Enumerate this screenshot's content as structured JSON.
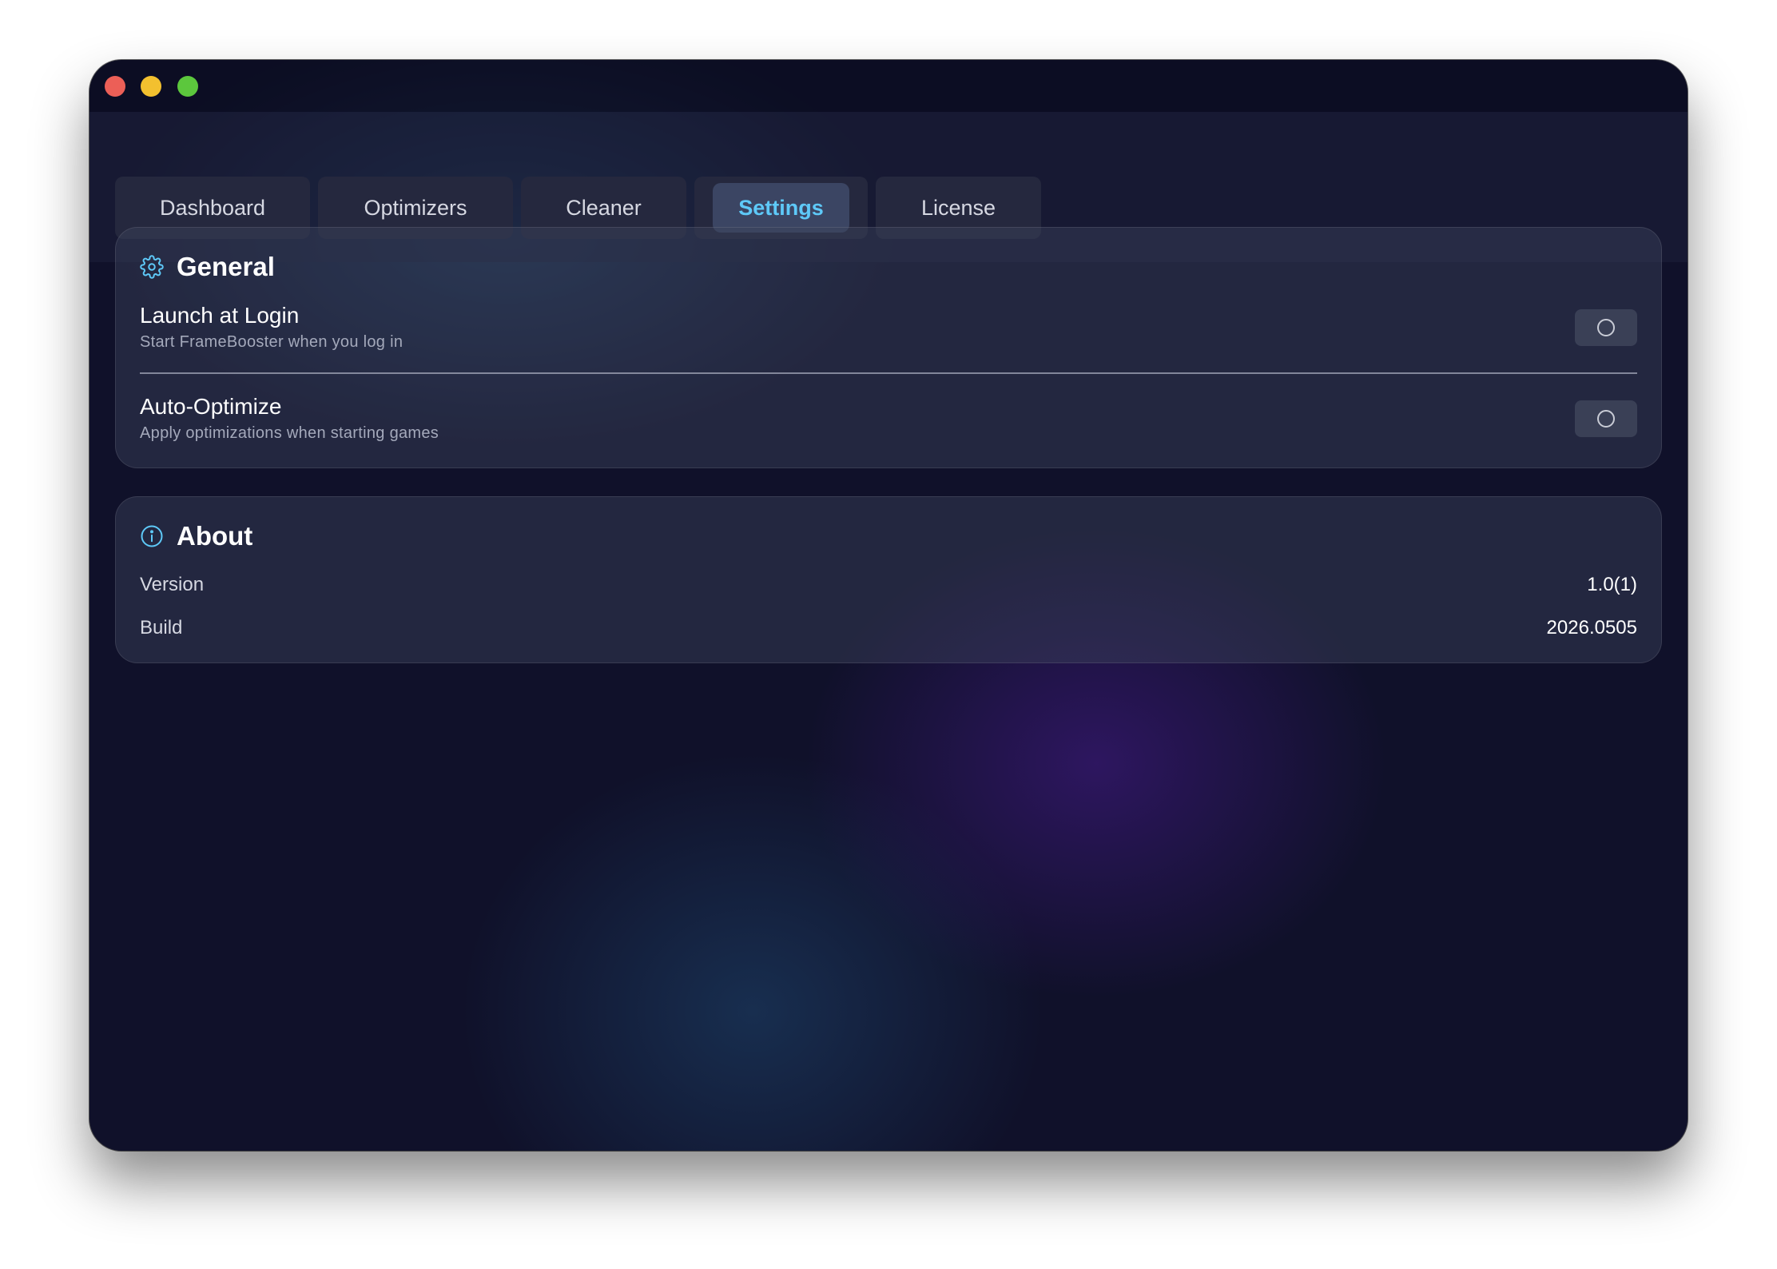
{
  "window": {
    "controls": [
      "close",
      "minimize",
      "zoom"
    ]
  },
  "tabs": [
    {
      "label": "Dashboard",
      "active": false
    },
    {
      "label": "Optimizers",
      "active": false
    },
    {
      "label": "Cleaner",
      "active": false
    },
    {
      "label": "Settings",
      "active": true
    },
    {
      "label": "License",
      "active": false
    }
  ],
  "general": {
    "icon": "gear-icon",
    "title": "General",
    "launch_at_login": {
      "title": "Launch at Login",
      "subtitle": "Start FrameBooster when you log in",
      "enabled": false
    },
    "auto_optimize": {
      "title": "Auto-Optimize",
      "subtitle": "Apply optimizations when starting games",
      "enabled": false
    }
  },
  "about": {
    "icon": "info-icon",
    "title": "About",
    "version_label": "Version",
    "version_value": "1.0(1)",
    "build_label": "Build",
    "build_value": "2026.0505"
  },
  "colors": {
    "accent": "#5ec9f8",
    "close": "#ec5f57",
    "minimize": "#f3c02f",
    "zoom": "#5cc73d",
    "background": "#10112a"
  }
}
